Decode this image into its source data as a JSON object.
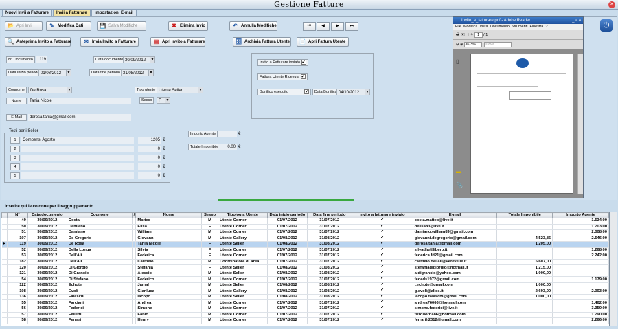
{
  "app_title": "Gestione Fatture",
  "tabs": [
    "Nuovi Invii a Fatturare",
    "Invii a Fatturare",
    "Impostazioni E-mail"
  ],
  "toolbar": {
    "apri_invii": "Apri Invii",
    "modifica_dati": "Modifica Dati",
    "salva_modifiche": "Salva Modifiche",
    "elimina_invio": "Elimina Invio",
    "annulla_modifiche": "Annulla Modifiche",
    "anteprima": "Anteprima Invito a Fatturare",
    "invia": "Invia Invito a Fatturare",
    "apri_invito": "Apri Invito a Fatturare",
    "archivia": "Archivia Fattura Utente",
    "apri_fattura": "Apri Fattura Utente"
  },
  "nav": [
    "⏮",
    "◀",
    "▶",
    "⏭"
  ],
  "form": {
    "n_documento_label": "N° Documento",
    "n_documento": "119",
    "data_documento_label": "Data documento",
    "data_documento": "30/09/2012",
    "data_inizio_label": "Data inizio periodo",
    "data_inizio": "01/08/2012",
    "data_fine_label": "Data fine periodo",
    "data_fine": "31/08/2012",
    "cognome_label": "Cognome",
    "cognome": "De Rosa",
    "nome_label": "Nome",
    "nome": "Tania Nicole",
    "tipo_utente_label": "Tipo utente",
    "tipo_utente": "Utente Seller",
    "sesso_label": "Sesso",
    "sesso": "F",
    "email_label": "E-Mail",
    "email": "derosa.tania@gmail.com",
    "invito_inviato_label": "Invito a Fatturare inviato",
    "fattura_ricevuta_label": "Fattura Utente Ricevuta",
    "bonifico_label": "Bonifico eseguito",
    "data_bonifico_label": "Data Bonifico",
    "data_bonifico": "04/10/2012",
    "testi_title": "Testi per i Seller",
    "testi": [
      {
        "n": "1",
        "text": "Compensi Agosto",
        "amount": "1205"
      },
      {
        "n": "2",
        "text": "",
        "amount": "0"
      },
      {
        "n": "3",
        "text": "",
        "amount": "0"
      },
      {
        "n": "4",
        "text": "",
        "amount": "0"
      },
      {
        "n": "5",
        "text": "",
        "amount": "0"
      }
    ],
    "euro": "€",
    "importo_agente_label": "Importo Agente",
    "importo_agente": "",
    "totale_imponibile_label": "Totale Imponibile",
    "totale_imponibile": "0,00"
  },
  "pdf": {
    "title": "Invito_a_fatturare.pdf - Adobe Reader",
    "menu": [
      "File",
      "Modifica",
      "Vista",
      "Documento",
      "Strumenti",
      "Finestra",
      "?"
    ],
    "page": "1",
    "pages": "/ 1",
    "zoom": "36,3%",
    "find": "Trova"
  },
  "group_hint": "Inserire qui le colonne per il raggruppamento",
  "columns": [
    "N°",
    "Data documento",
    "Cognome",
    "/",
    "Nome",
    "Sesso",
    "Tipologia Utente",
    "Data inizio periodo",
    "Data fine periodo",
    "Invito a fatturare inviato",
    "E-mail",
    "Totale Imponibile",
    "Importo Agente"
  ],
  "rows": [
    [
      "49",
      "30/09/2012",
      "Costa",
      "Matteo",
      "M",
      "Utente Corner",
      "01/07/2012",
      "31/07/2012",
      "costa.matteo@live.it",
      "",
      "1.534,00"
    ],
    [
      "50",
      "30/09/2012",
      "Damiano",
      "Elisa",
      "F",
      "Utente Corner",
      "01/07/2012",
      "31/07/2012",
      "delisa83@live.it",
      "",
      "1.703,00"
    ],
    [
      "51",
      "30/09/2012",
      "Damiano",
      "William",
      "M",
      "Utente Corner",
      "01/07/2012",
      "31/07/2012",
      "damiano.william89@gmail.com",
      "",
      "2.008,00"
    ],
    [
      "107",
      "30/09/2012",
      "De Gregorio",
      "Giovanni",
      "M",
      "Utente Gallery",
      "01/08/2012",
      "31/08/2012",
      "giovanni.degregorio@gmail.com",
      "4.523,86",
      "2.546,00"
    ],
    [
      "119",
      "30/09/2012",
      "De Rosa",
      "Tania Nicole",
      "F",
      "Utente Seller",
      "01/08/2012",
      "31/08/2012",
      "derosa.tania@gmail.com",
      "1.205,00",
      ""
    ],
    [
      "52",
      "30/09/2012",
      "Della Longa",
      "Silvia",
      "F",
      "Utente Corner",
      "01/07/2012",
      "31/07/2012",
      "silvadla@libero.it",
      "",
      "1.268,00"
    ],
    [
      "53",
      "30/09/2012",
      "Dell'Ali",
      "Federica",
      "F",
      "Utente Corner",
      "01/07/2012",
      "31/07/2012",
      "federica.fd21@gmail.com",
      "",
      "2.242,00"
    ],
    [
      "182",
      "30/09/2012",
      "Dell'Ali",
      "Carmelo",
      "M",
      "Coordinatore di Area",
      "01/07/2012",
      "31/07/2012",
      "carmelo.dellali@verevelle.it",
      "5.607,00",
      ""
    ],
    [
      "120",
      "30/09/2012",
      "Di Giorgio",
      "Stefania",
      "F",
      "Utente Seller",
      "01/08/2012",
      "31/08/2012",
      "stefaniadigiorgio@hotmail.it",
      "1.215,00",
      ""
    ],
    [
      "121",
      "30/09/2012",
      "Di Grancio",
      "Alessio",
      "M",
      "Utente Seller",
      "01/08/2012",
      "31/08/2012",
      "a.digrancio@yahoo.com",
      "1.000,00",
      ""
    ],
    [
      "54",
      "30/09/2012",
      "Di Stefano",
      "Federico",
      "M",
      "Utente Corner",
      "01/07/2012",
      "31/07/2012",
      "fededs1972@gmail.com",
      "",
      "1.179,00"
    ],
    [
      "122",
      "30/09/2012",
      "Echote",
      "Jamal",
      "M",
      "Utente Seller",
      "01/08/2012",
      "31/08/2012",
      "j.echote@gmail.com",
      "1.000,00",
      ""
    ],
    [
      "108",
      "30/09/2012",
      "Evoli",
      "Gianluca",
      "M",
      "Utente Gallery",
      "01/08/2012",
      "31/08/2012",
      "g.evoli@alice.it",
      "2.693,00",
      "2.093,00"
    ],
    [
      "136",
      "30/09/2012",
      "Falaschi",
      "Iacopo",
      "M",
      "Utente Seller",
      "01/08/2012",
      "31/08/2012",
      "iacopo.falaschi@gmail.com",
      "1.000,00",
      ""
    ],
    [
      "55",
      "30/09/2012",
      "Farciani",
      "Andrea",
      "M",
      "Utente Corner",
      "01/07/2012",
      "31/07/2012",
      "andrea76066@hotmail.com",
      "",
      "1.462,00"
    ],
    [
      "56",
      "30/09/2012",
      "Federici",
      "Simone",
      "M",
      "Utente Corner",
      "01/07/2012",
      "31/07/2012",
      "simone.federici@live.it",
      "",
      "3.350,00"
    ],
    [
      "57",
      "30/09/2012",
      "Felletti",
      "Fabio",
      "M",
      "Utente Corner",
      "01/07/2012",
      "31/07/2012",
      "fuzquorna86@hotmail.com",
      "",
      "1.790,00"
    ],
    [
      "58",
      "30/09/2012",
      "Ferrari",
      "Henry",
      "M",
      "Utente Corner",
      "01/07/2012",
      "31/07/2012",
      "ferrarih2012@gmail.com",
      "",
      "2.266,00"
    ]
  ],
  "selected_row": 4
}
